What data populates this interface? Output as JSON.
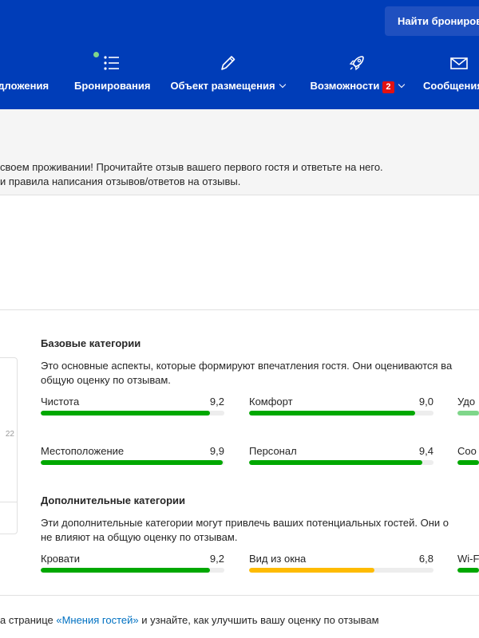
{
  "header": {
    "find_button": "Найти бронирования",
    "nav": [
      {
        "label": "едложения",
        "icon": "none"
      },
      {
        "label": "Бронирования",
        "icon": "list-icon"
      },
      {
        "label": "Объект размещения",
        "icon": "pencil-icon",
        "dropdown": true
      },
      {
        "label": "Возможности",
        "icon": "rocket-icon",
        "dropdown": true,
        "badge": "2"
      },
      {
        "label": "Сообщения",
        "icon": "envelope-icon"
      }
    ]
  },
  "notice": {
    "line1": "своем проживании! Прочитайте отзыв вашего первого гостя и ответьте на него.",
    "line2": "и правила написания отзывов/ответов на отзывы."
  },
  "left_card": {
    "partial_value": "22"
  },
  "basic": {
    "title": "Базовые категории",
    "desc_line1": "Это основные аспекты, которые формируют впечатления гостя. Они оцениваются ва",
    "desc_line2": "общую оценку по отзывам.",
    "metrics": [
      {
        "name": "Чистота",
        "score": "9,2",
        "value": 9.2
      },
      {
        "name": "Комфорт",
        "score": "9,0",
        "value": 9.0
      },
      {
        "name": "Удо",
        "score": "",
        "value": 9.0
      },
      {
        "name": "Местоположение",
        "score": "9,9",
        "value": 9.9
      },
      {
        "name": "Персонал",
        "score": "9,4",
        "value": 9.4
      },
      {
        "name": "Соо",
        "score": "",
        "value": 9.0
      }
    ]
  },
  "extra": {
    "title": "Дополнительные категории",
    "desc_line1": "Эти дополнительные категории могут привлечь ваших потенциальных гостей. Они о",
    "desc_line2": "не влияют на общую оценку по отзывам.",
    "metrics": [
      {
        "name": "Кровати",
        "score": "9,2",
        "value": 9.2
      },
      {
        "name": "Вид из окна",
        "score": "6,8",
        "value": 6.8
      },
      {
        "name": "Wi-F",
        "score": "",
        "value": 9.0
      }
    ]
  },
  "footer": {
    "prefix": "а странице ",
    "link": "«Мнения гостей»",
    "suffix": " и узнайте, как улучшить вашу оценку по отзывам"
  },
  "colors": {
    "header_bg": "#003db8",
    "good": "#00a800",
    "warning": "#febb02",
    "link": "#0071c2",
    "badge": "#e21111"
  }
}
